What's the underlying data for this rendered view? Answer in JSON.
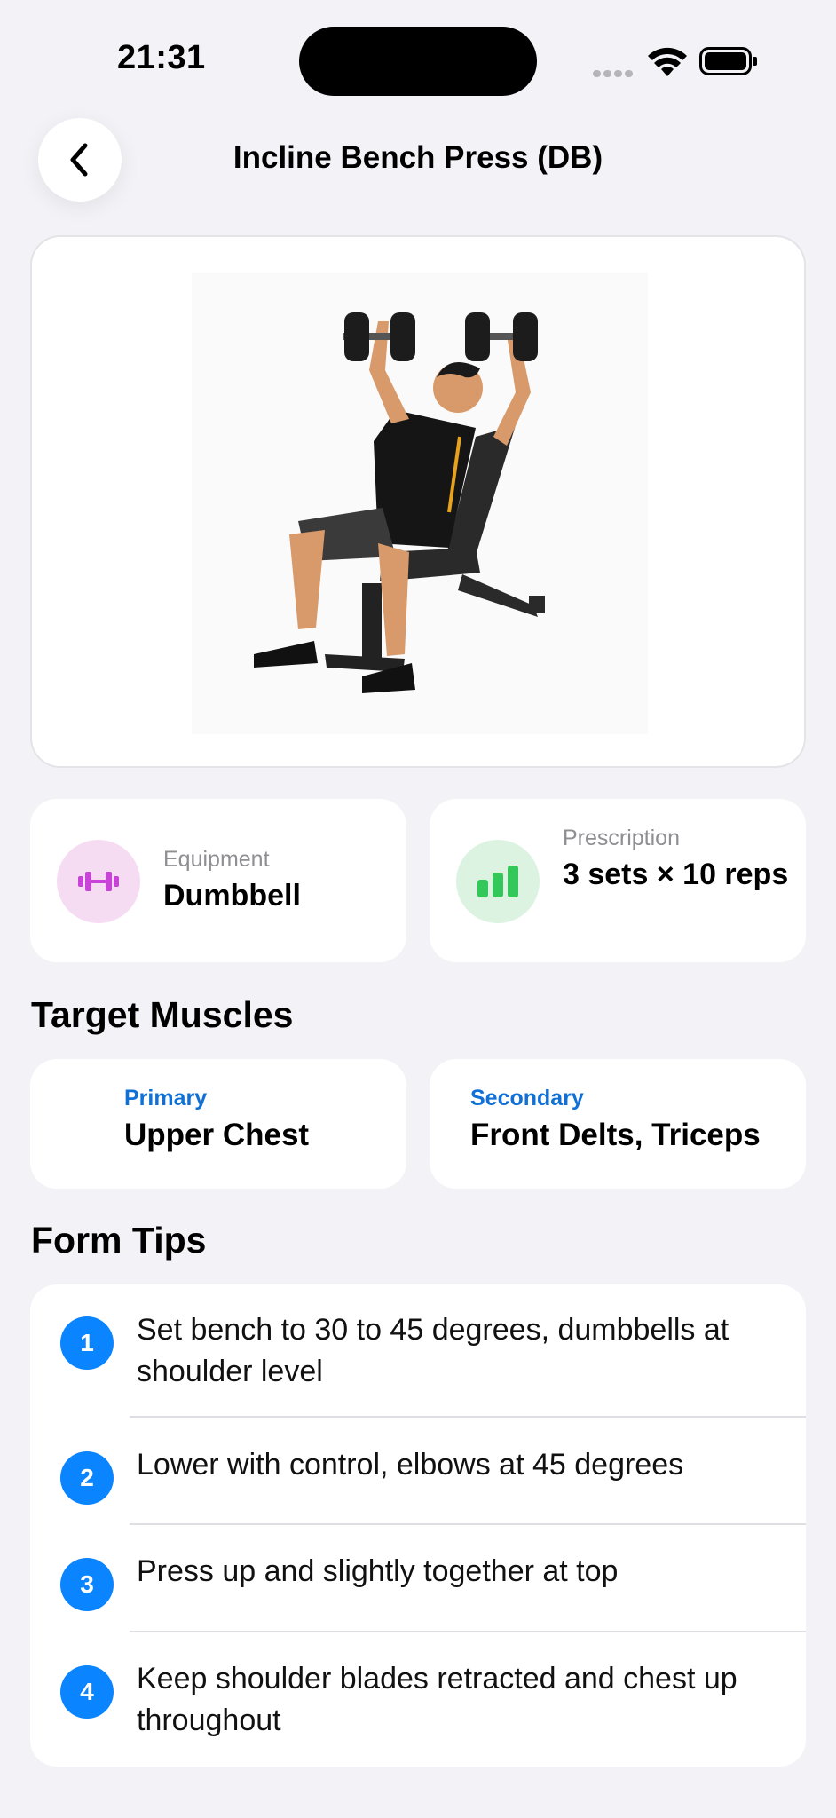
{
  "status_bar": {
    "time": "21:31"
  },
  "header": {
    "title": "Incline Bench Press (DB)",
    "back_icon": "chevron-left-icon"
  },
  "hero": {
    "image": "person-incline-dumbbell-press-illustration"
  },
  "equipment": {
    "label": "Equipment",
    "value": "Dumbbell",
    "icon": "dumbbell-icon",
    "icon_color": "#c744d6"
  },
  "prescription": {
    "label": "Prescription",
    "value": "3 sets × 10 reps",
    "icon": "bar-chart-icon",
    "icon_color": "#34c759"
  },
  "target_muscles": {
    "title": "Target Muscles",
    "primary": {
      "label": "Primary",
      "value": "Upper Chest"
    },
    "secondary": {
      "label": "Secondary",
      "value": "Front Delts, Triceps"
    }
  },
  "form_tips": {
    "title": "Form Tips",
    "items": [
      {
        "number": "1",
        "text": "Set bench to 30 to 45 degrees, dumbbells at shoulder level"
      },
      {
        "number": "2",
        "text": "Lower with control, elbows at 45 degrees"
      },
      {
        "number": "3",
        "text": "Press up and slightly together at top"
      },
      {
        "number": "4",
        "text": "Keep shoulder blades retracted and chest up throughout"
      }
    ]
  },
  "colors": {
    "accent": "#0a84ff",
    "label_blue": "#1070d6",
    "background": "#f2f2f7"
  }
}
